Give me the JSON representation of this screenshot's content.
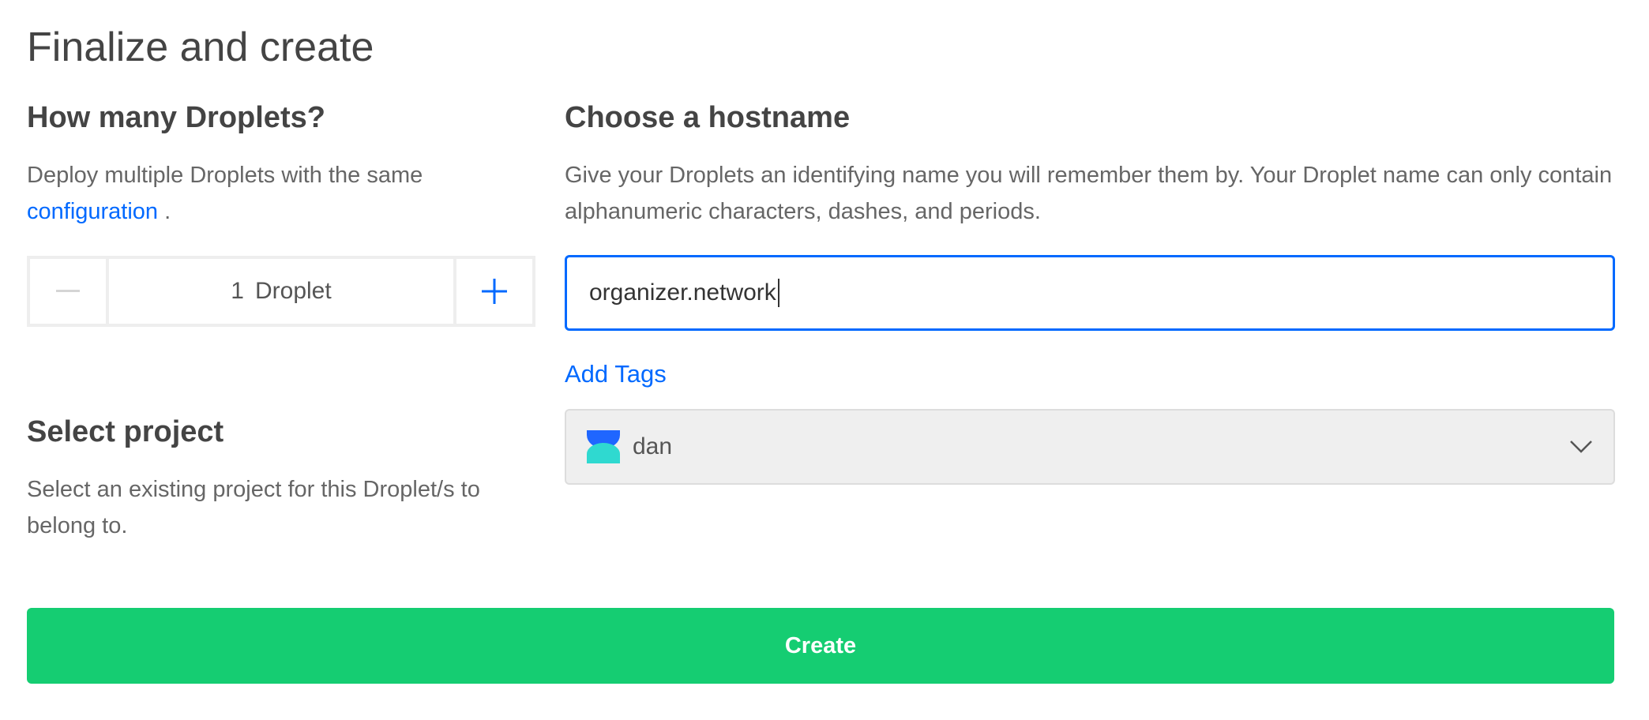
{
  "page": {
    "title": "Finalize and create"
  },
  "droplets": {
    "heading": "How many Droplets?",
    "description_prefix": "Deploy multiple Droplets with the same",
    "description_link": "configuration",
    "description_suffix": ".",
    "stepper": {
      "count": "1",
      "unit": "Droplet"
    }
  },
  "hostname": {
    "heading": "Choose a hostname",
    "description": "Give your Droplets an identifying name you will remember them by. Your Droplet name can only contain alphanumeric characters, dashes, and periods.",
    "value": "organizer.network"
  },
  "tags": {
    "add_label": "Add Tags"
  },
  "project": {
    "heading": "Select project",
    "description": "Select an existing project for this Droplet/s to belong to.",
    "selected": "dan"
  },
  "actions": {
    "create_label": "Create"
  },
  "colors": {
    "accent": "#0069ff",
    "create": "#15cd72",
    "avatar_top": "#1f66ff",
    "avatar_bottom": "#2fd9d0"
  }
}
